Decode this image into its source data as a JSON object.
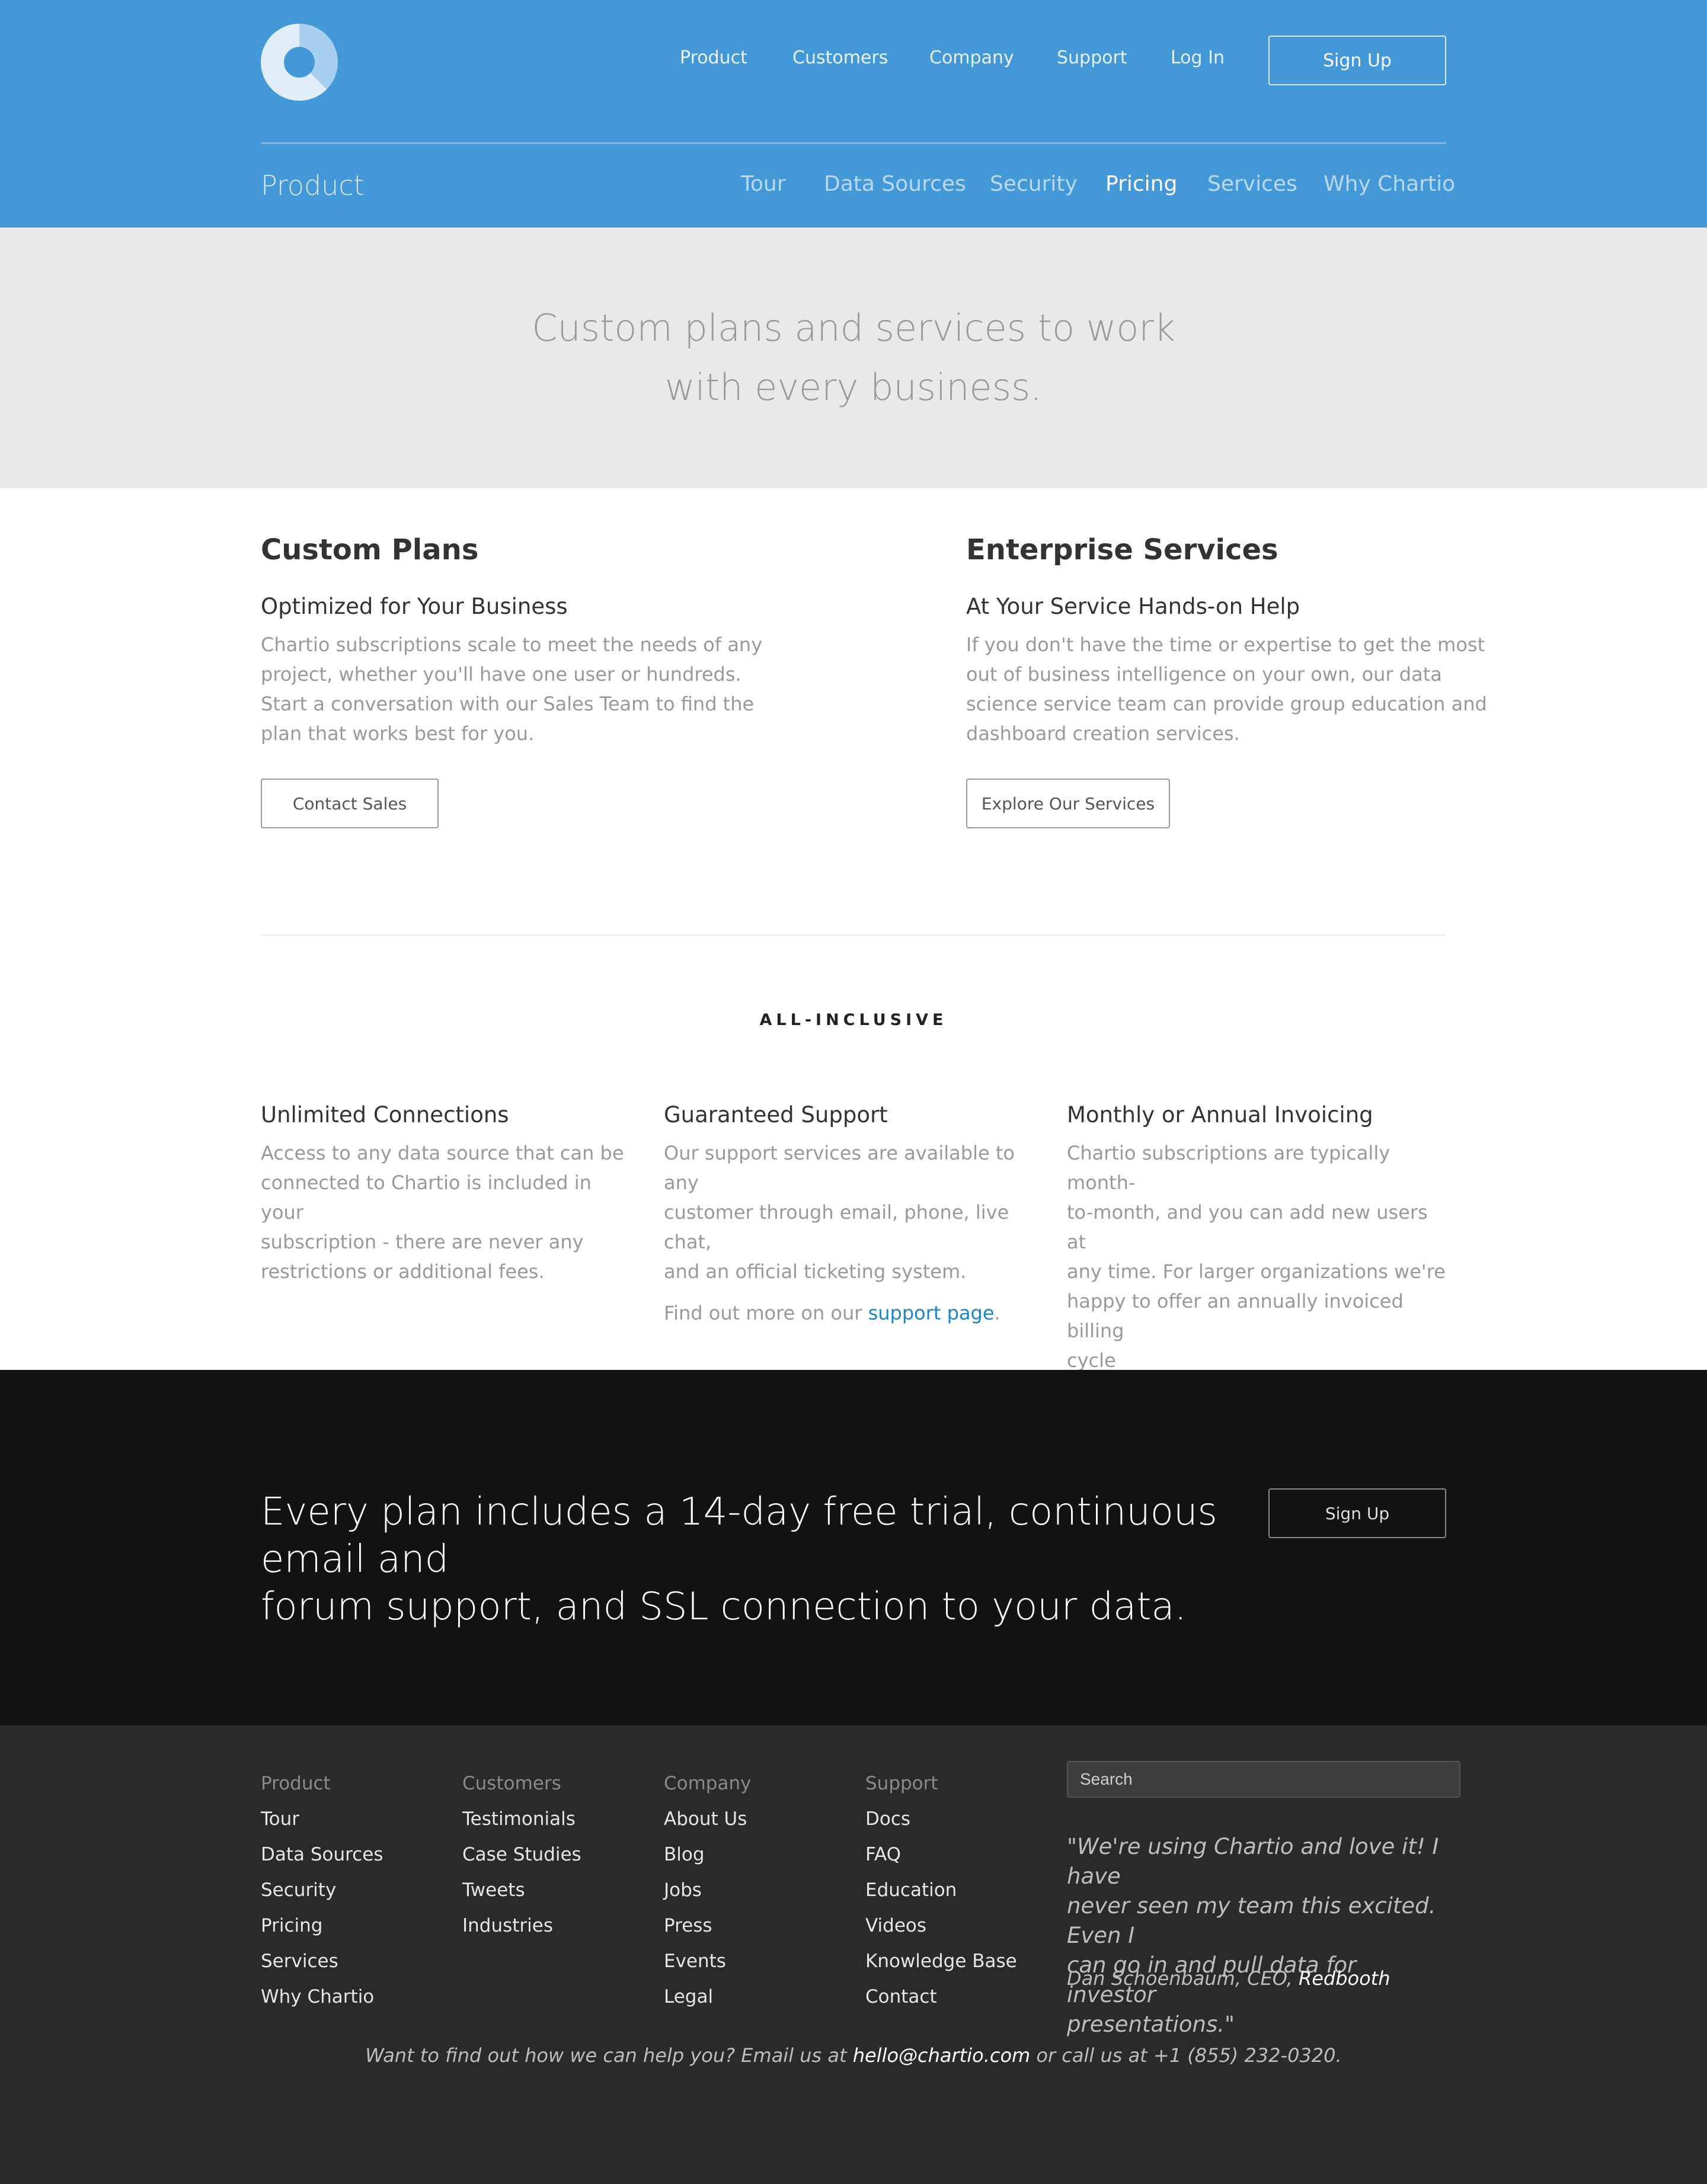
{
  "header": {
    "nav": [
      "Product",
      "Customers",
      "Company",
      "Support",
      "Log In"
    ],
    "signup": "Sign Up",
    "section_title": "Product",
    "subnav": [
      "Tour",
      "Data Sources",
      "Security",
      "Pricing",
      "Services",
      "Why Chartio"
    ],
    "active_subnav": "Pricing"
  },
  "hero": {
    "line1": "Custom plans and services to work",
    "line2": "with every business."
  },
  "plans": {
    "custom": {
      "title": "Custom Plans",
      "subtitle": "Optimized for Your Business",
      "lines": [
        "Chartio subscriptions scale to meet the needs of any",
        "project, whether you'll have one user or hundreds.",
        "Start a conversation with our Sales Team to find the",
        "plan that works best for you."
      ],
      "button": "Contact Sales"
    },
    "enterprise": {
      "title": "Enterprise Services",
      "subtitle": "At Your Service Hands-on Help",
      "lines": [
        "If you don't have the time or expertise to get the most",
        "out of business intelligence on your own, our data",
        "science service team can provide group education and",
        "dashboard creation services."
      ],
      "button": "Explore Our Services"
    }
  },
  "all_inclusive": {
    "heading": "ALL-INCLUSIVE",
    "features": [
      {
        "title": "Unlimited Connections",
        "lines": [
          "Access to any data source that can be",
          "connected to Chartio is included in your",
          "subscription - there are never any",
          "restrictions or additional fees."
        ]
      },
      {
        "title": "Guaranteed Support",
        "lines": [
          "Our support services are available to any",
          "customer through email, phone, live chat,",
          "and an official ticketing system."
        ],
        "more_prefix": "Find out more on our ",
        "more_link": "support page",
        "more_suffix": "."
      },
      {
        "title": "Monthly or Annual Invoicing",
        "lines": [
          "Chartio subscriptions are typically month-",
          "to-month, and you can add new users at",
          "any time. For larger organizations we're",
          "happy to offer an annually invoiced billing",
          "cycle"
        ]
      }
    ]
  },
  "cta": {
    "line1": "Every plan includes a 14-day free trial, continuous email and",
    "line2": "forum support, and SSL connection to your data.",
    "button": "Sign Up"
  },
  "footer": {
    "columns": [
      {
        "heading": "Product",
        "links": [
          "Tour",
          "Data Sources",
          "Security",
          "Pricing",
          "Services",
          "Why Chartio"
        ]
      },
      {
        "heading": "Customers",
        "links": [
          "Testimonials",
          "Case Studies",
          "Tweets",
          "Industries"
        ]
      },
      {
        "heading": "Company",
        "links": [
          "About Us",
          "Blog",
          "Jobs",
          "Press",
          "Events",
          "Legal"
        ]
      },
      {
        "heading": "Support",
        "links": [
          "Docs",
          "FAQ",
          "Education",
          "Videos",
          "Knowledge Base",
          "Contact"
        ]
      }
    ],
    "search_placeholder": "Search",
    "quote_lines": [
      "\"We're using Chartio and love it! I have",
      "never seen my team this excited. Even I",
      "can go in and pull data for investor",
      "presentations.\""
    ],
    "attribution_prefix": "Dan Schoenbaum, CEO, ",
    "attribution_company": "Redbooth",
    "contact_prefix": "Want to find out how we can help you? Email us at ",
    "contact_email": "hello@chartio.com",
    "contact_suffix": " or call us at +1 (855) 232-0320."
  }
}
